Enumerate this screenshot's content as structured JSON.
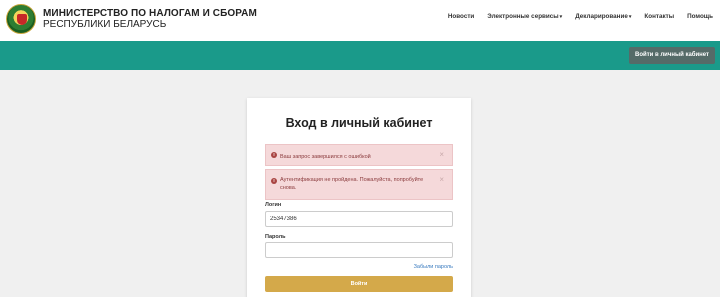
{
  "header": {
    "org_line1": "МИНИСТЕРСТВО ПО НАЛОГАМ И СБОРАМ",
    "org_line2": "РЕСПУБЛИКИ БЕЛАРУСЬ",
    "logo_icon": "emblem-icon"
  },
  "nav": {
    "items": [
      {
        "label": "Новости",
        "dropdown": false
      },
      {
        "label": "Электронные сервисы",
        "dropdown": true
      },
      {
        "label": "Декларирование",
        "dropdown": true
      },
      {
        "label": "Контакты",
        "dropdown": false
      },
      {
        "label": "Помощь",
        "dropdown": false
      }
    ],
    "caret": "▾"
  },
  "banner": {
    "cabinet_button": "Войти в личный кабинет",
    "color": "#1a9a8a"
  },
  "login": {
    "title": "Вход в личный кабинет",
    "alerts": [
      {
        "text": "Ваш запрос завершился с ошибкой",
        "icon": "error-icon",
        "close": "×"
      },
      {
        "text": "Аутентификация не пройдена. Пожалуйста, попробуйте снова.",
        "icon": "error-icon",
        "close": "×"
      }
    ],
    "login_label": "Логин",
    "login_value": "25347386",
    "password_label": "Пароль",
    "password_value": "",
    "forgot_link": "Забыли пароль",
    "submit_button": "Войти",
    "accent_color": "#d4a94a"
  }
}
